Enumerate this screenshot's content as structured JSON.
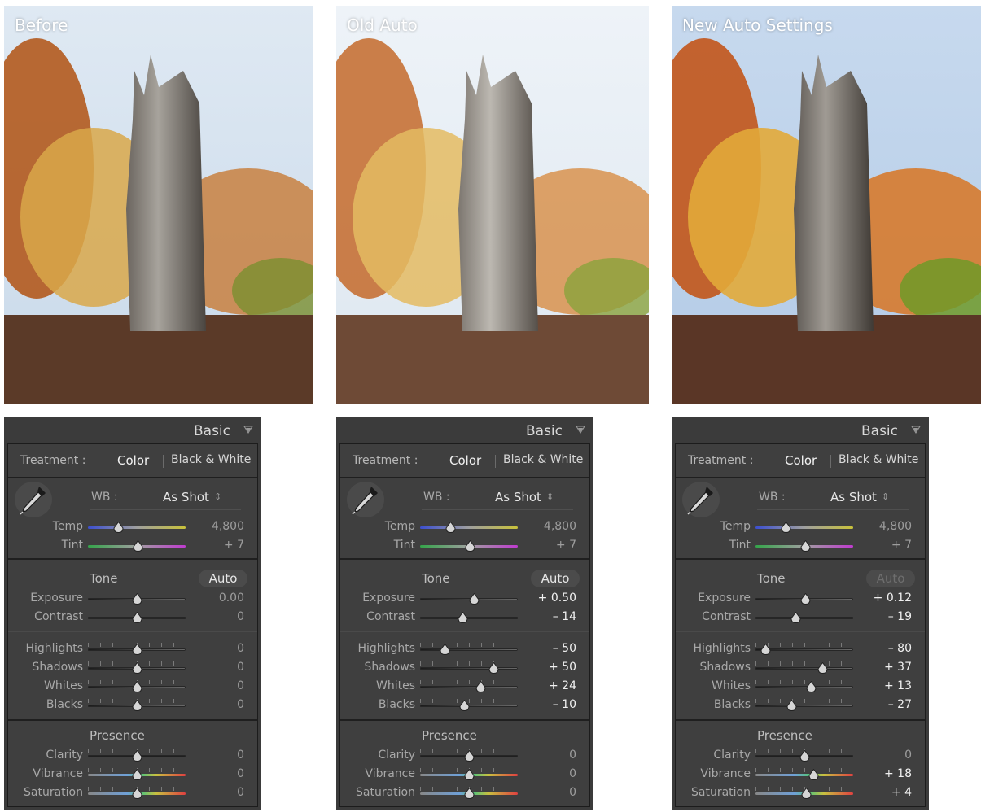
{
  "photos": [
    {
      "label": "Before"
    },
    {
      "label": "Old Auto"
    },
    {
      "label": "New Auto Settings"
    }
  ],
  "panels": [
    {
      "header": {
        "title": "Basic"
      },
      "treatment": {
        "label": "Treatment :",
        "color": "Color",
        "bw": "Black & White"
      },
      "wb": {
        "label": "WB :",
        "value": "As Shot"
      },
      "temp": {
        "label": "Temp",
        "value": "4,800",
        "position": 0.31
      },
      "tint": {
        "label": "Tint",
        "value": "+ 7",
        "position": 0.51
      },
      "tone": {
        "title": "Tone",
        "auto": "Auto"
      },
      "exposure": {
        "label": "Exposure",
        "value": "0.00",
        "position": 0.5
      },
      "contrast": {
        "label": "Contrast",
        "value": "0",
        "position": 0.5
      },
      "highlights": {
        "label": "Highlights",
        "value": "0",
        "position": 0.5
      },
      "shadows": {
        "label": "Shadows",
        "value": "0",
        "position": 0.5
      },
      "whites": {
        "label": "Whites",
        "value": "0",
        "position": 0.5
      },
      "blacks": {
        "label": "Blacks",
        "value": "0",
        "position": 0.5
      },
      "presence": {
        "title": "Presence"
      },
      "clarity": {
        "label": "Clarity",
        "value": "0",
        "position": 0.5
      },
      "vibrance": {
        "label": "Vibrance",
        "value": "0",
        "position": 0.5
      },
      "saturation": {
        "label": "Saturation",
        "value": "0",
        "position": 0.5
      }
    },
    {
      "header": {
        "title": "Basic"
      },
      "treatment": {
        "label": "Treatment :",
        "color": "Color",
        "bw": "Black & White"
      },
      "wb": {
        "label": "WB :",
        "value": "As Shot"
      },
      "temp": {
        "label": "Temp",
        "value": "4,800",
        "position": 0.31
      },
      "tint": {
        "label": "Tint",
        "value": "+ 7",
        "position": 0.51
      },
      "tone": {
        "title": "Tone",
        "auto": "Auto"
      },
      "exposure": {
        "label": "Exposure",
        "value": "+ 0.50",
        "position": 0.55
      },
      "contrast": {
        "label": "Contrast",
        "value": "– 14",
        "position": 0.43
      },
      "highlights": {
        "label": "Highlights",
        "value": "– 50",
        "position": 0.25
      },
      "shadows": {
        "label": "Shadows",
        "value": "+ 50",
        "position": 0.75
      },
      "whites": {
        "label": "Whites",
        "value": "+ 24",
        "position": 0.62
      },
      "blacks": {
        "label": "Blacks",
        "value": "– 10",
        "position": 0.45
      },
      "presence": {
        "title": "Presence"
      },
      "clarity": {
        "label": "Clarity",
        "value": "0",
        "position": 0.5
      },
      "vibrance": {
        "label": "Vibrance",
        "value": "0",
        "position": 0.5
      },
      "saturation": {
        "label": "Saturation",
        "value": "0",
        "position": 0.5
      }
    },
    {
      "header": {
        "title": "Basic"
      },
      "treatment": {
        "label": "Treatment :",
        "color": "Color",
        "bw": "Black & White"
      },
      "wb": {
        "label": "WB :",
        "value": "As Shot"
      },
      "temp": {
        "label": "Temp",
        "value": "4,800",
        "position": 0.31
      },
      "tint": {
        "label": "Tint",
        "value": "+ 7",
        "position": 0.51
      },
      "tone": {
        "title": "Tone",
        "auto": "Auto"
      },
      "exposure": {
        "label": "Exposure",
        "value": "+ 0.12",
        "position": 0.51
      },
      "contrast": {
        "label": "Contrast",
        "value": "– 19",
        "position": 0.41
      },
      "highlights": {
        "label": "Highlights",
        "value": "– 80",
        "position": 0.1
      },
      "shadows": {
        "label": "Shadows",
        "value": "+ 37",
        "position": 0.68
      },
      "whites": {
        "label": "Whites",
        "value": "+ 13",
        "position": 0.57
      },
      "blacks": {
        "label": "Blacks",
        "value": "– 27",
        "position": 0.37
      },
      "presence": {
        "title": "Presence"
      },
      "clarity": {
        "label": "Clarity",
        "value": "0",
        "position": 0.5
      },
      "vibrance": {
        "label": "Vibrance",
        "value": "+ 18",
        "position": 0.59
      },
      "saturation": {
        "label": "Saturation",
        "value": "+ 4",
        "position": 0.52
      }
    }
  ]
}
